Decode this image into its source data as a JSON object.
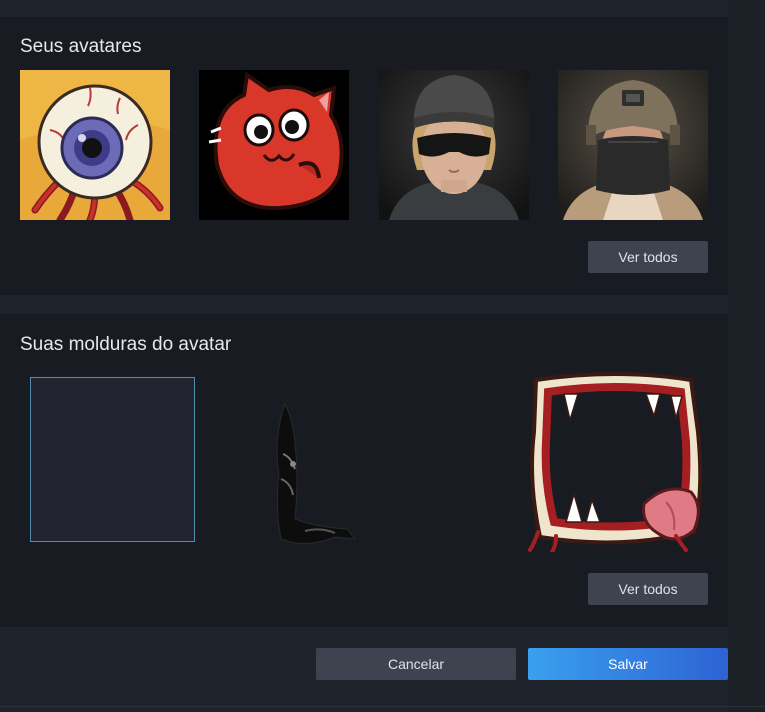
{
  "avatars_section": {
    "title": "Seus avatares",
    "view_all_label": "Ver todos",
    "items": [
      {
        "icon": "eyeball-monster-avatar"
      },
      {
        "icon": "red-blob-cat-avatar"
      },
      {
        "icon": "soldier-woman-avatar"
      },
      {
        "icon": "soldier-helmet-avatar"
      }
    ]
  },
  "frames_section": {
    "title": "Suas molduras do avatar",
    "view_all_label": "Ver todos",
    "items": [
      {
        "icon": "empty-frame",
        "selected": true
      },
      {
        "icon": "dark-tentacle-frame"
      },
      {
        "icon": "monster-mouth-frame"
      }
    ]
  },
  "footer": {
    "cancel_label": "Cancelar",
    "save_label": "Salvar"
  },
  "colors": {
    "panel": "#181b21",
    "background": "#1f232b",
    "button_dark": "#3d4450",
    "primary_start": "#3aa0ee",
    "primary_end": "#2d63d4",
    "selected_border": "#4f8fae"
  }
}
